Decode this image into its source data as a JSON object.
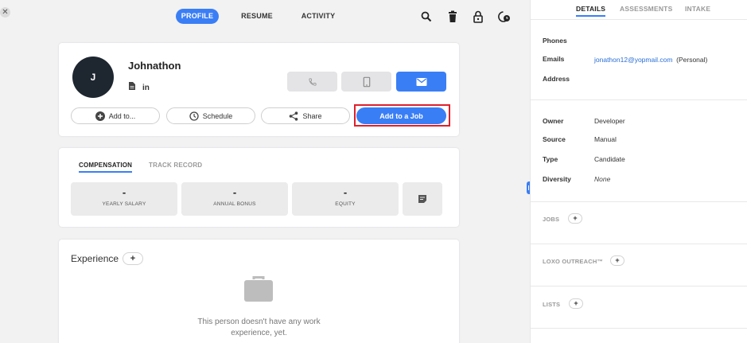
{
  "nav": {
    "tabs": [
      {
        "label": "PROFILE",
        "active": true
      },
      {
        "label": "RESUME",
        "active": false
      },
      {
        "label": "ACTIVITY",
        "active": false
      }
    ],
    "icons": [
      "search-icon",
      "trash-icon",
      "lock-icon",
      "clock-icon"
    ]
  },
  "profile": {
    "initial": "J",
    "name": "Johnathon",
    "linkedin_label": "in",
    "actions": {
      "add_to": "Add to...",
      "schedule": "Schedule",
      "share": "Share",
      "add_to_job": "Add to a Job"
    }
  },
  "compensation": {
    "tabs": [
      {
        "label": "COMPENSATION",
        "active": true
      },
      {
        "label": "TRACK RECORD",
        "active": false
      }
    ],
    "boxes": [
      {
        "value": "-",
        "label": "YEARLY SALARY"
      },
      {
        "value": "-",
        "label": "ANNUAL BONUS"
      },
      {
        "value": "-",
        "label": "EQUITY"
      }
    ]
  },
  "experience": {
    "title": "Experience",
    "add_label": "+",
    "empty_line1": "This person doesn't have any work",
    "empty_line2": "experience, yet."
  },
  "details": {
    "tabs": [
      {
        "label": "DETAILS",
        "active": true
      },
      {
        "label": "ASSESSMENTS",
        "active": false
      },
      {
        "label": "INTAKE",
        "active": false
      }
    ],
    "contact": {
      "phones_label": "Phones",
      "emails_label": "Emails",
      "email_value": "jonathon12@yopmail.com",
      "email_type": "(Personal)",
      "address_label": "Address"
    },
    "meta": [
      {
        "label": "Owner",
        "value": "Developer"
      },
      {
        "label": "Source",
        "value": "Manual"
      },
      {
        "label": "Type",
        "value": "Candidate"
      },
      {
        "label": "Diversity",
        "value": "None"
      }
    ],
    "sections": {
      "jobs": "JOBS",
      "outreach": "LOXO OUTREACH™",
      "lists": "LISTS",
      "plus": "+"
    }
  },
  "colors": {
    "accent": "#3a7ef5",
    "highlight": "#e0202a",
    "avatar": "#1e2630",
    "link": "#2a6fd6"
  }
}
